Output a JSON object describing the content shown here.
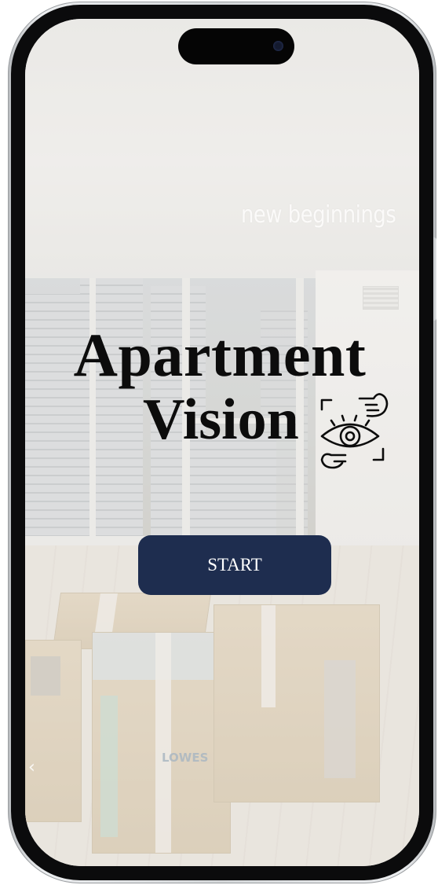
{
  "photo": {
    "overlay_text": "new beginnings",
    "box_brand": "LOWES"
  },
  "app": {
    "title_line1": "Apartment",
    "title_line2": "Vision",
    "logo_icon": "eye-with-pointing-hands-icon",
    "start_label": "START"
  },
  "colors": {
    "button_bg": "#1e2d4f",
    "button_text": "#ffffff",
    "title_text": "#0c0c0c"
  }
}
